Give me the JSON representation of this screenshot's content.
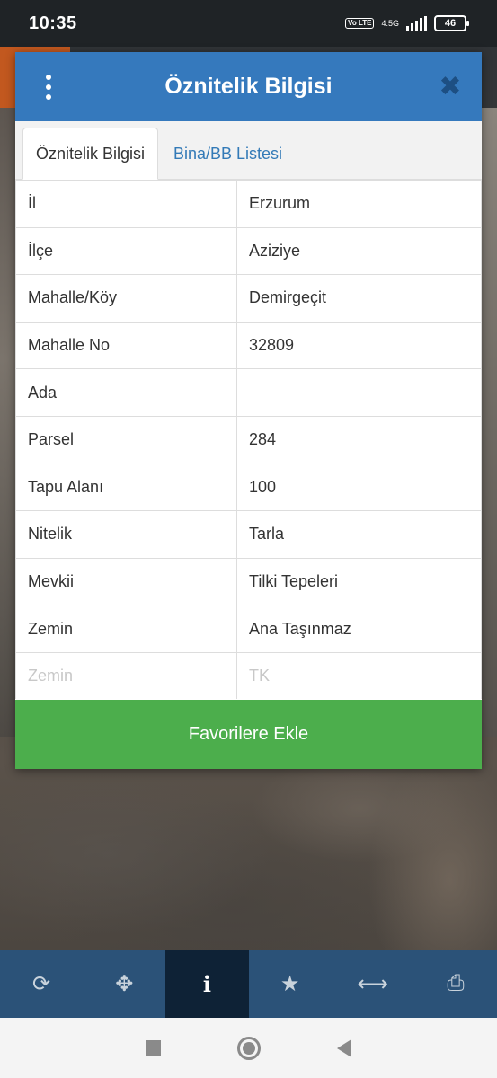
{
  "status_bar": {
    "time": "10:35",
    "volte": "Vo LTE",
    "network": "4.5G",
    "battery": "46"
  },
  "dialog": {
    "title": "Öznitelik Bilgisi",
    "tabs": [
      {
        "label": "Öznitelik Bilgisi",
        "active": true
      },
      {
        "label": "Bina/BB Listesi",
        "active": false
      }
    ],
    "rows": [
      {
        "key": "İl",
        "value": "Erzurum"
      },
      {
        "key": "İlçe",
        "value": "Aziziye"
      },
      {
        "key": "Mahalle/Köy",
        "value": "Demirgeçit"
      },
      {
        "key": "Mahalle No",
        "value": "32809"
      },
      {
        "key": "Ada",
        "value": ""
      },
      {
        "key": "Parsel",
        "value": "284"
      },
      {
        "key": "Tapu Alanı",
        "value": "100"
      },
      {
        "key": "Nitelik",
        "value": "Tarla"
      },
      {
        "key": "Mevkii",
        "value": "Tilki Tepeleri"
      },
      {
        "key": "Zemin",
        "value": "Ana Taşınmaz"
      },
      {
        "key": "Zemin",
        "value": "TK"
      }
    ],
    "favorite_button": "Favorilere Ekle"
  },
  "toolbar": {
    "items": [
      {
        "icon": "refresh-icon",
        "glyph": "⟳"
      },
      {
        "icon": "crosshair-icon",
        "glyph": "✥"
      },
      {
        "icon": "info-icon",
        "glyph": "i",
        "active": true
      },
      {
        "icon": "star-icon",
        "glyph": "★"
      },
      {
        "icon": "measure-icon",
        "glyph": "⟷"
      },
      {
        "icon": "print-icon",
        "glyph": "⎙"
      }
    ]
  },
  "colors": {
    "header": "#3579bd",
    "button": "#4cae4c",
    "toolbar": "#2b5278",
    "toolbar_active": "#0e2236"
  }
}
